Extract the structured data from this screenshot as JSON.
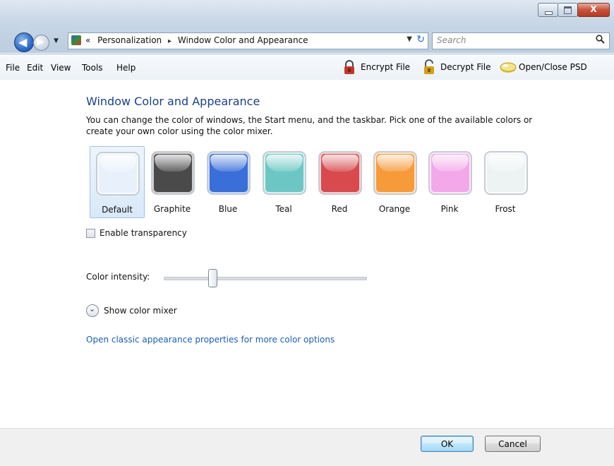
{
  "nav": {
    "back_glyph": "◀",
    "forward_glyph": "▶",
    "dropdown_glyph": "▼"
  },
  "address": {
    "prefix": "«",
    "crumbs": [
      "Personalization",
      "Window Color and Appearance"
    ],
    "separator": "▸",
    "dropdown_glyph": "▼",
    "refresh_glyph": "↻"
  },
  "search": {
    "placeholder": "Search",
    "icon": "search-icon"
  },
  "menu": {
    "file": "File",
    "edit": "Edit",
    "view": "View",
    "tools": "Tools",
    "help": "Help"
  },
  "toolbar": {
    "encrypt": "Encrypt File",
    "decrypt": "Decrypt File",
    "openclose": "Open/Close PSD"
  },
  "page": {
    "title": "Window Color and Appearance",
    "description": "You can change the color of windows, the Start menu, and the taskbar. Pick one of the available colors or create your own color using the color mixer."
  },
  "swatches": [
    {
      "label": "Default",
      "color": "#e8f1fb",
      "selected": true
    },
    {
      "label": "Graphite",
      "color": "#4a4a4a"
    },
    {
      "label": "Blue",
      "color": "#3a6ed8"
    },
    {
      "label": "Teal",
      "color": "#6cc7c4"
    },
    {
      "label": "Red",
      "color": "#d84a4e"
    },
    {
      "label": "Orange",
      "color": "#f79a3a"
    },
    {
      "label": "Pink",
      "color": "#f3a8ea"
    },
    {
      "label": "Frost",
      "color": "#edf3f3"
    }
  ],
  "transparency": {
    "label": "Enable transparency",
    "checked": false
  },
  "intensity": {
    "label": "Color intensity:",
    "value_fraction": 0.24
  },
  "mixer": {
    "label": "Show color mixer",
    "glyph": "⌄"
  },
  "classic_link": "Open classic appearance properties for more color options",
  "buttons": {
    "ok": "OK",
    "cancel": "Cancel"
  },
  "window_controls": {
    "close_glyph": "X"
  }
}
